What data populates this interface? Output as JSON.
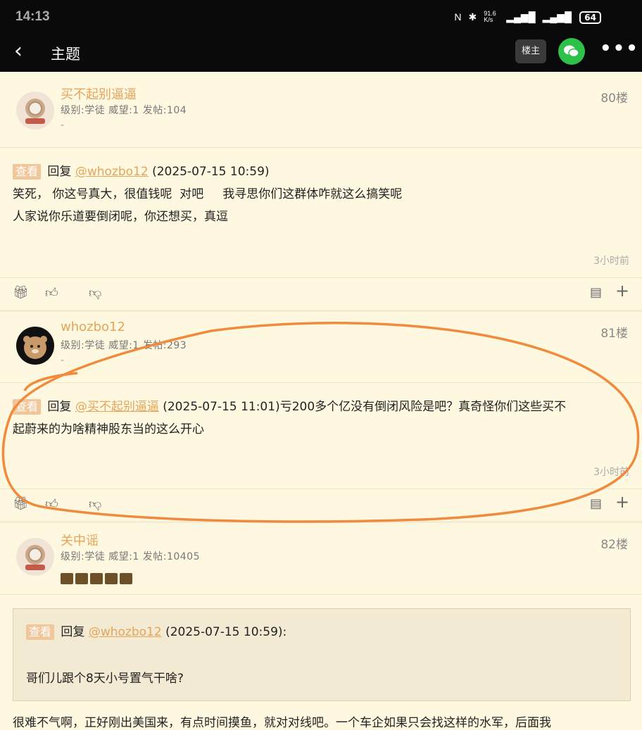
{
  "status": {
    "time": "14:13",
    "net": "91.6 K/s",
    "battery": "64"
  },
  "header": {
    "title": "主题",
    "louzhu_label": "楼主"
  },
  "posts": [
    {
      "username": "买不起别逼逼",
      "level": "级别:学徒 威望:1 发帖:104",
      "sub": "-",
      "floor": "80楼",
      "tag": "查看",
      "reply_word": "回复",
      "mention": "@whozbo12",
      "reply_time": "(2025-07-15 10:59)",
      "line1": "笑死， 你这号真大，很值钱呢  对吧     我寻思你们这群体咋就这么搞笑呢",
      "line2": "人家说你乐道要倒闭呢，你还想买，真逗",
      "ago": "3小时前"
    },
    {
      "username": "whozbo12",
      "level": "级别:学徒 威望:1 发帖:293",
      "sub": "-",
      "floor": "81楼",
      "tag": "查看",
      "reply_word": "回复",
      "mention": "@买不起别逼逼",
      "reply_time": "(2025-07-15 11:01)亏200多个亿没有倒闭风险是吧？真奇怪你们这些买不",
      "line1": "起蔚来的为啥精神股东当的这么开心",
      "ago": "3小时前"
    },
    {
      "username": "关中谣",
      "level": "级别:学徒 威望:1 发帖:10405",
      "floor": "82楼",
      "quote_tag": "查看",
      "quote_reply": "回复",
      "quote_mention": "@whozbo12",
      "quote_time": "(2025-07-15 10:59):",
      "quote_text": "哥们儿跟个8天小号置气干啥?",
      "line1": "很难不气啊，正好刚出美国来，有点时间摸鱼，就对对线吧。一个车企如果只会找这样的水军，后面我"
    }
  ],
  "colors": {
    "accent": "#e4a55a",
    "bg": "#fff8e1",
    "annotation": "#f08a3c"
  }
}
